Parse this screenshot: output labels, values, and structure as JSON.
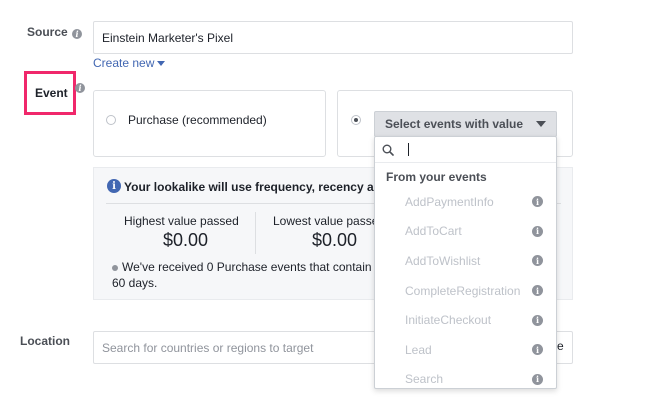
{
  "source": {
    "label": "Source",
    "value": "Einstein Marketer's Pixel",
    "create_new": "Create new"
  },
  "event": {
    "label": "Event",
    "option_purchase": "Purchase (recommended)",
    "select_button": "Select events with value"
  },
  "info_panel": {
    "headline": "Your lookalike will use frequency, recency and",
    "highest_label": "Highest value passed",
    "highest_value": "$0.00",
    "lowest_label": "Lowest value passe",
    "lowest_value": "$0.00",
    "note_line1": "We've received 0 Purchase events that contain v",
    "note_line2": "60 days."
  },
  "location": {
    "label": "Location",
    "placeholder": "Search for countries or regions to target",
    "right_fragment": "e"
  },
  "dropdown": {
    "search_value": "",
    "header": "From your events",
    "items": [
      {
        "label": "AddPaymentInfo"
      },
      {
        "label": "AddToCart"
      },
      {
        "label": "AddToWishlist"
      },
      {
        "label": "CompleteRegistration"
      },
      {
        "label": "InitiateCheckout"
      },
      {
        "label": "Lead"
      },
      {
        "label": "Search"
      }
    ]
  },
  "colors": {
    "accent_blue": "#4267b2",
    "highlight_pink": "#f0286b",
    "muted_text": "#bec2c9"
  }
}
